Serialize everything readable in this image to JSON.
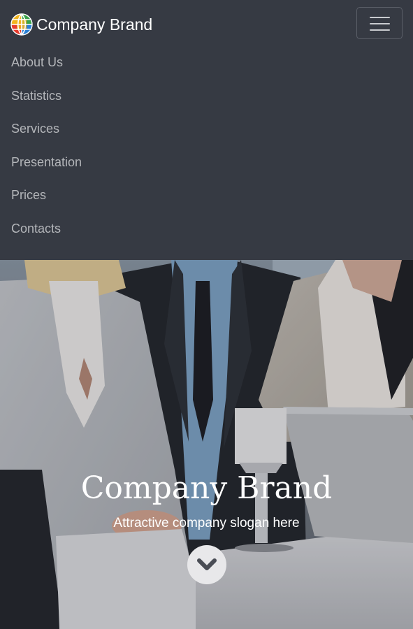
{
  "navbar": {
    "brand_name": "Company Brand",
    "brand_logo_icon": "globe-logo-icon",
    "toggler_icon": "hamburger-menu-icon",
    "menu_items": [
      "About Us",
      "Statistics",
      "Services",
      "Presentation",
      "Prices",
      "Contacts"
    ]
  },
  "hero": {
    "title": "Company Brand",
    "slogan": "Attractive company slogan here",
    "scroll_icon": "chevron-down-icon"
  },
  "colors": {
    "navbar_background": "#363a43",
    "menu_text": "#b4b6ba",
    "brand_text": "#ffffff",
    "hero_text": "#ffffff",
    "scroll_button": "#e8e8ea",
    "scroll_chevron": "#4a4d55"
  }
}
